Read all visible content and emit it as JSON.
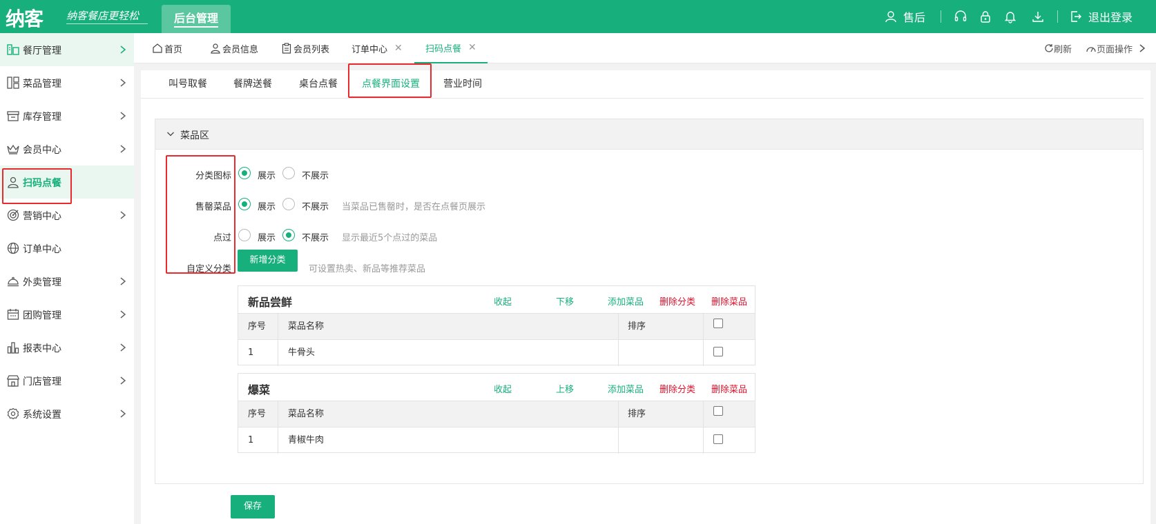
{
  "header": {
    "logo": "纳客",
    "slogan": "纳客餐店更轻松",
    "admin_tab": "后台管理",
    "after_sales": "售后",
    "logout": "退出登录"
  },
  "sidebar": {
    "items": [
      {
        "label": "餐厅管理",
        "icon": "restaurant-icon"
      },
      {
        "label": "菜品管理",
        "icon": "dishes-icon"
      },
      {
        "label": "库存管理",
        "icon": "inventory-icon"
      },
      {
        "label": "会员中心",
        "icon": "crown-icon"
      },
      {
        "label": "扫码点餐",
        "icon": "user-icon"
      },
      {
        "label": "营销中心",
        "icon": "target-icon"
      },
      {
        "label": "订单中心",
        "icon": "globe-icon"
      },
      {
        "label": "外卖管理",
        "icon": "cloche-icon"
      },
      {
        "label": "团购管理",
        "icon": "calendar-icon"
      },
      {
        "label": "报表中心",
        "icon": "bar-chart-icon"
      },
      {
        "label": "门店管理",
        "icon": "store-icon"
      },
      {
        "label": "系统设置",
        "icon": "gear-icon"
      }
    ]
  },
  "page_tabs": {
    "tabs": [
      {
        "label": "首页"
      },
      {
        "label": "会员信息"
      },
      {
        "label": "会员列表"
      },
      {
        "label": "订单中心"
      },
      {
        "label": "扫码点餐"
      }
    ],
    "refresh": "刷新",
    "page_ops": "页面操作"
  },
  "sub_tabs": {
    "items": [
      "叫号取餐",
      "餐牌送餐",
      "桌台点餐",
      "点餐界面设置",
      "营业时间"
    ],
    "active": "点餐界面设置"
  },
  "dish_section": {
    "title": "菜品区",
    "rows": [
      {
        "label": "分类图标",
        "option_show": "展示",
        "option_hide": "不展示",
        "selected": "展示",
        "hint": ""
      },
      {
        "label": "售罄菜品",
        "option_show": "展示",
        "option_hide": "不展示",
        "selected": "展示",
        "hint": "当菜品已售罄时，是否在点餐页展示"
      },
      {
        "label": "点过",
        "option_show": "展示",
        "option_hide": "不展示",
        "selected": "不展示",
        "hint": "显示最近5个点过的菜品"
      }
    ],
    "custom_category": {
      "label": "自定义分类",
      "button": "新增分类",
      "hint": "可设置热卖、新品等推荐菜品"
    },
    "table_headers": {
      "index": "序号",
      "name": "菜品名称",
      "sort": "排序"
    },
    "categories": [
      {
        "name": "新品尝鲜",
        "actions": {
          "collapse": "收起",
          "move": "下移",
          "add": "添加菜品",
          "delete_category": "删除分类",
          "delete_dish": "删除菜品"
        },
        "dishes": [
          {
            "index": "1",
            "name": "牛骨头",
            "sort": ""
          }
        ]
      },
      {
        "name": "爆菜",
        "actions": {
          "collapse": "收起",
          "move": "上移",
          "add": "添加菜品",
          "delete_category": "删除分类",
          "delete_dish": "删除菜品"
        },
        "dishes": [
          {
            "index": "1",
            "name": "青椒牛肉",
            "sort": ""
          }
        ]
      }
    ]
  },
  "save_button": "保存",
  "colors": {
    "brand": "#17b07c",
    "danger": "#e0112b",
    "highlight": "#e8292e"
  }
}
